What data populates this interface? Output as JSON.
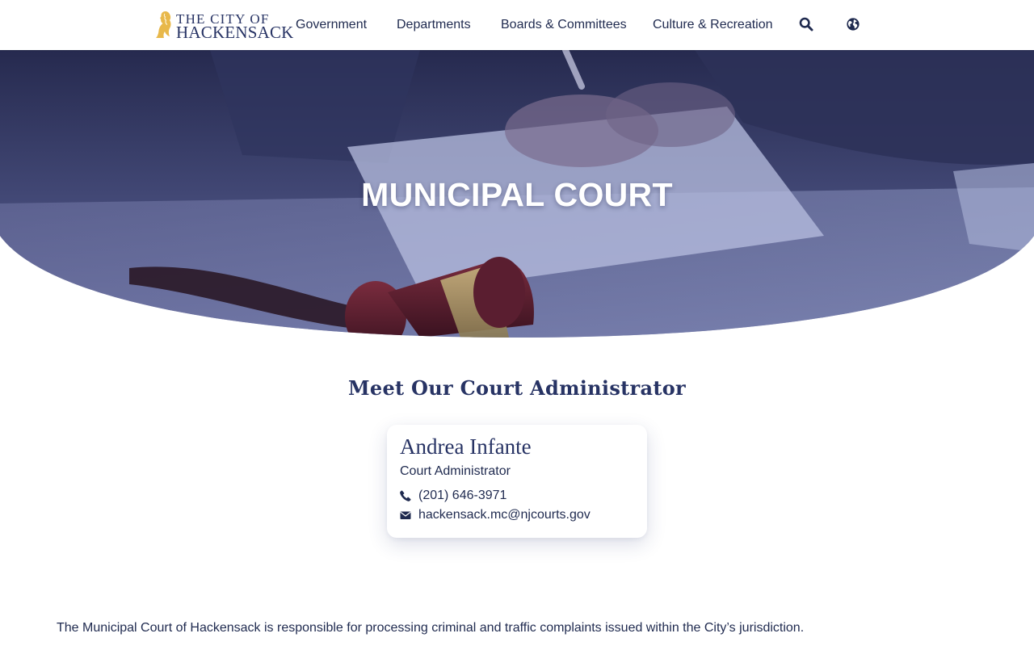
{
  "header": {
    "logo": {
      "line1": "THE CITY OF",
      "line2": "HACKENSACK",
      "icon": "hackensack-figure-logo",
      "accent": "#e8b84a"
    },
    "nav": [
      {
        "label": "Government"
      },
      {
        "label": "Departments"
      },
      {
        "label": "Boards & Committees"
      },
      {
        "label": "Culture & Recreation"
      }
    ],
    "icons": {
      "search": "search-icon",
      "language": "globe-icon"
    }
  },
  "hero": {
    "title": "MUNICIPAL COURT",
    "overlay_color": "#2b3470"
  },
  "administrator_section": {
    "heading": "Meet Our Court Administrator",
    "card": {
      "name": "Andrea Infante",
      "role": "Court Administrator",
      "phone": "(201) 646-3971",
      "phone_icon": "phone-icon",
      "email": "hackensack.mc@njcourts.gov",
      "email_icon": "envelope-icon"
    }
  },
  "intro": {
    "text": "The Municipal Court of Hackensack is responsible for processing criminal and traffic complaints issued within the City’s jurisdiction."
  },
  "colors": {
    "text": "#1f2a4f",
    "heading": "#273364",
    "background": "#ffffff"
  }
}
